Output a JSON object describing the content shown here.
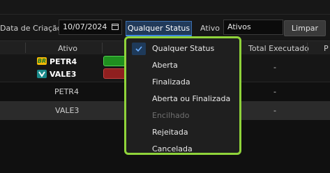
{
  "filters": {
    "date_label": "Data de Criação",
    "date_value": "10/07/2024",
    "status_selected": "Qualquer Status",
    "ativo_label": "Ativo",
    "ativo_value": "Ativos",
    "clear_label": "Limpar"
  },
  "grid": {
    "headers": [
      "Ativo",
      "Total Executado",
      "P"
    ],
    "groups": [
      {
        "ticker": "PETR4",
        "logo": "petrobras-logo",
        "bar_color": "#1f8f1f"
      },
      {
        "ticker": "VALE3",
        "logo": "vale-logo",
        "bar_color": "#8f1f1f"
      }
    ],
    "rows": [
      {
        "ativo": "PETR4",
        "total": "-"
      },
      {
        "ativo": "VALE3",
        "total": "-"
      }
    ],
    "group_total": "-"
  },
  "dropdown": {
    "items": [
      {
        "label": "Qualquer Status",
        "checked": true,
        "disabled": false
      },
      {
        "label": "Aberta",
        "checked": false,
        "disabled": false
      },
      {
        "label": "Finalizada",
        "checked": false,
        "disabled": false
      },
      {
        "label": "Aberta ou Finalizada",
        "checked": false,
        "disabled": false
      },
      {
        "label": "Encilhado",
        "checked": false,
        "disabled": true
      },
      {
        "label": "Rejeitada",
        "checked": false,
        "disabled": false
      },
      {
        "label": "Cancelada",
        "checked": false,
        "disabled": false
      }
    ]
  },
  "colors": {
    "highlight": "#8fd33a",
    "accent": "#3b86e0",
    "buy": "#1f8f1f",
    "sell": "#8f1f1f"
  }
}
